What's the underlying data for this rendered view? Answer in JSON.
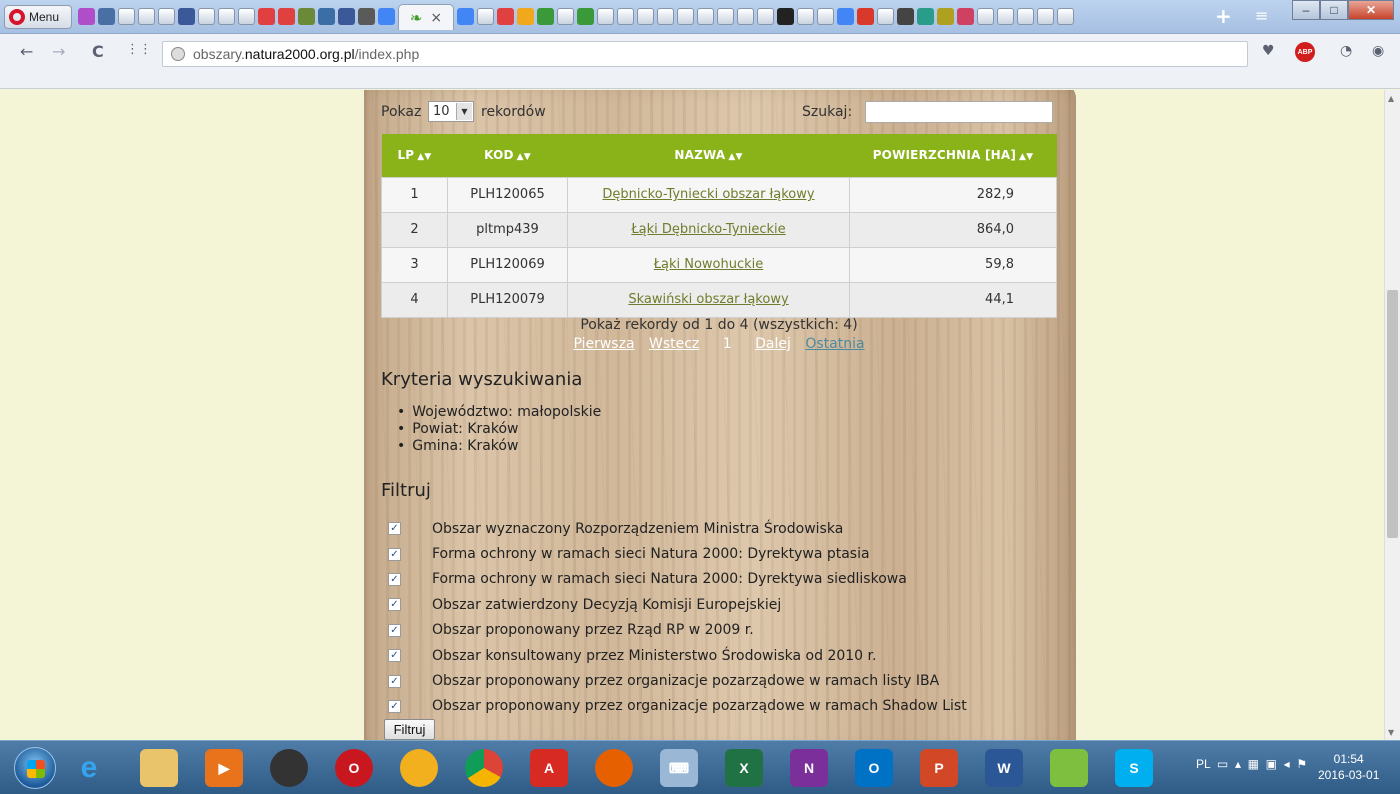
{
  "browser": {
    "menu_label": "Menu",
    "url_path": "obszary.natura2000.org.pl/index.php",
    "url_domain": "natura2000.org.pl",
    "url_prefix": "obszary.",
    "url_suffix": "/index.php"
  },
  "table_controls": {
    "show_prefix": "Pokaz",
    "page_size": "10",
    "show_suffix": "rekordów",
    "search_label": "Szukaj:",
    "search_value": ""
  },
  "results": {
    "columns": [
      "LP",
      "KOD",
      "NAZWA",
      "POWIERZCHNIA [HA]"
    ],
    "rows": [
      {
        "lp": "1",
        "kod": "PLH120065",
        "nazwa": "Dębnicko-Tyniecki obszar łąkowy",
        "area": "282,9"
      },
      {
        "lp": "2",
        "kod": "pltmp439",
        "nazwa": "Łąki Dębnicko-Tynieckie",
        "area": "864,0"
      },
      {
        "lp": "3",
        "kod": "PLH120069",
        "nazwa": "Łąki Nowohuckie",
        "area": "59,8"
      },
      {
        "lp": "4",
        "kod": "PLH120079",
        "nazwa": "Skawiński obszar łąkowy",
        "area": "44,1"
      }
    ],
    "info": "Pokaż rekordy od 1 do 4 (wszystkich: 4)"
  },
  "pager": {
    "first": "Pierwsza",
    "prev": "Wstecz",
    "current": "1",
    "next": "Dalej",
    "last": "Ostatnia"
  },
  "criteria": {
    "title": "Kryteria wyszukiwania",
    "items": [
      "Województwo: małopolskie",
      "Powiat: Kraków",
      "Gmina: Kraków"
    ]
  },
  "filter": {
    "title": "Filtruj",
    "options": [
      {
        "label": "Obszar wyznaczony Rozporządzeniem Ministra Środowiska",
        "checked": true
      },
      {
        "label": "Forma ochrony w ramach sieci Natura 2000: Dyrektywa ptasia",
        "checked": true
      },
      {
        "label": "Forma ochrony w ramach sieci Natura 2000: Dyrektywa siedliskowa",
        "checked": true
      },
      {
        "label": "Obszar zatwierdzony Decyzją Komisji Europejskiej",
        "checked": true
      },
      {
        "label": "Obszar proponowany przez Rząd RP w 2009 r.",
        "checked": true
      },
      {
        "label": "Obszar konsultowany przez Ministerstwo Środowiska od 2010 r.",
        "checked": true
      },
      {
        "label": "Obszar proponowany przez organizacje pozarządowe w ramach listy IBA",
        "checked": true
      },
      {
        "label": "Obszar proponowany przez organizacje pozarządowe w ramach Shadow List",
        "checked": true
      }
    ],
    "button_label": "Filtruj"
  },
  "taskbar": {
    "language": "PL",
    "time": "01:54",
    "date": "2016-03-01"
  },
  "colors": {
    "table_header": "#8ab31a",
    "link": "#6e7d2c",
    "page_bg": "#f4f4d6"
  }
}
